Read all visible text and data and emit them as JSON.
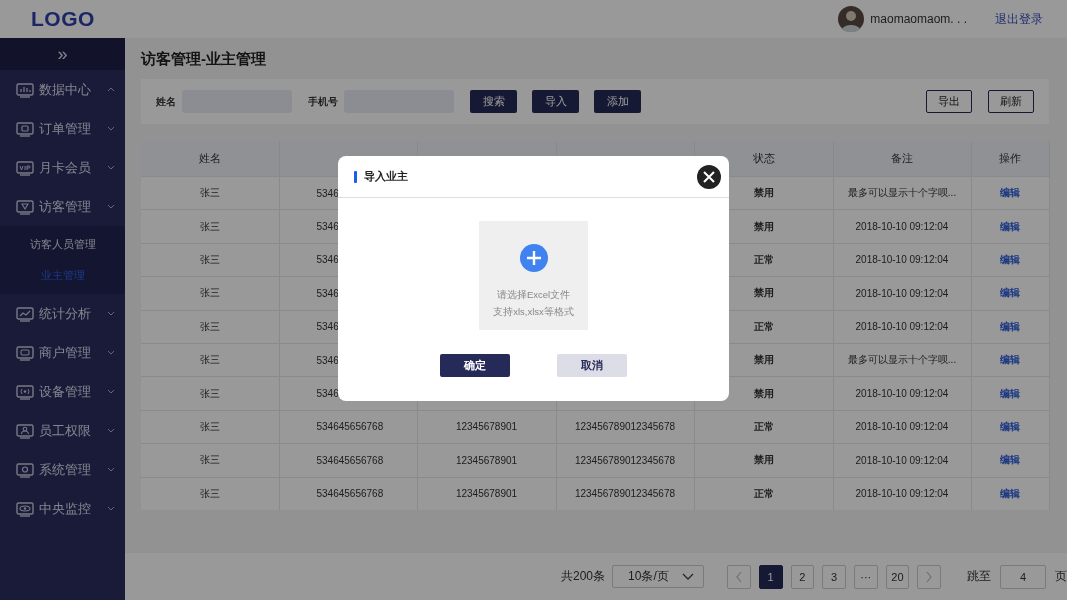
{
  "header": {
    "logo": "LOGO",
    "user_name": "maomaomaom. . .",
    "logout": "退出登录"
  },
  "sidebar": {
    "toggle": "»",
    "items": [
      {
        "label": "数据中心",
        "expanded": true
      },
      {
        "label": "订单管理",
        "expanded": false
      },
      {
        "label": "月卡会员",
        "expanded": false
      },
      {
        "label": "访客管理",
        "expanded": false,
        "children": [
          {
            "label": "访客人员管理",
            "selected": false
          },
          {
            "label": "业主管理",
            "selected": true
          }
        ]
      },
      {
        "label": "统计分析",
        "expanded": false
      },
      {
        "label": "商户管理",
        "expanded": false
      },
      {
        "label": "设备管理",
        "expanded": false
      },
      {
        "label": "员工权限",
        "expanded": false
      },
      {
        "label": "系统管理",
        "expanded": false
      },
      {
        "label": "中央监控",
        "expanded": false
      }
    ]
  },
  "page_title": "访客管理-业主管理",
  "filters": {
    "fields": [
      {
        "label": "姓名"
      },
      {
        "label": "手机号"
      }
    ],
    "buttons": [
      "搜索",
      "导入",
      "添加"
    ],
    "right_buttons": [
      "导出",
      "刷新"
    ]
  },
  "table": {
    "columns": {
      "column_1": "姓名",
      "column_5": "状态",
      "column_6": "备注",
      "column_7": "操作"
    },
    "rows": [
      {
        "name": "张三",
        "room": "5346",
        "status": "禁用",
        "remark": "最多可以显示十个字呗...",
        "action": "编辑"
      },
      {
        "name": "张三",
        "room": "5346",
        "status": "禁用",
        "remark": "2018-10-10   09:12:04",
        "action": "编辑"
      },
      {
        "name": "张三",
        "room": "5346",
        "status": "正常",
        "remark": "2018-10-10   09:12:04",
        "action": "编辑"
      },
      {
        "name": "张三",
        "room": "5346",
        "status": "禁用",
        "remark": "2018-10-10   09:12:04",
        "action": "编辑"
      },
      {
        "name": "张三",
        "room": "5346",
        "status": "正常",
        "remark": "2018-10-10   09:12:04",
        "action": "编辑"
      },
      {
        "name": "张三",
        "room": "5346",
        "status": "禁用",
        "remark": "最多可以显示十个字呗...",
        "action": "编辑"
      },
      {
        "name": "张三",
        "room": "5346",
        "status": "禁用",
        "remark": "2018-10-10   09:12:04",
        "action": "编辑"
      },
      {
        "name": "张三",
        "room": "534645656768",
        "phone": "12345678901",
        "id_no": "123456789012345678",
        "status": "正常",
        "remark": "2018-10-10   09:12:04",
        "action": "编辑"
      },
      {
        "name": "张三",
        "room": "534645656768",
        "phone": "12345678901",
        "id_no": "123456789012345678",
        "status": "禁用",
        "remark": "2018-10-10   09:12:04",
        "action": "编辑"
      },
      {
        "name": "张三",
        "room": "534645656768",
        "phone": "12345678901",
        "id_no": "123456789012345678",
        "status": "正常",
        "remark": "2018-10-10   09:12:04",
        "action": "编辑"
      }
    ]
  },
  "pagination": {
    "total": "共200条",
    "page_size": "10条/页",
    "pages": [
      {
        "label": "1",
        "selected": true
      },
      {
        "label": "2",
        "selected": false
      },
      {
        "label": "3",
        "selected": false
      },
      {
        "label": "···",
        "selected": false
      },
      {
        "label": "20",
        "selected": false
      }
    ],
    "jump_label": "跳至",
    "jump_value": "4",
    "page_suffix": "页"
  },
  "dialog": {
    "title": "导入业主",
    "upload_hint": "请选择Excel文件",
    "upload_formats": "支持xls,xlsx等格式",
    "confirm": "确定",
    "cancel": "取消"
  }
}
